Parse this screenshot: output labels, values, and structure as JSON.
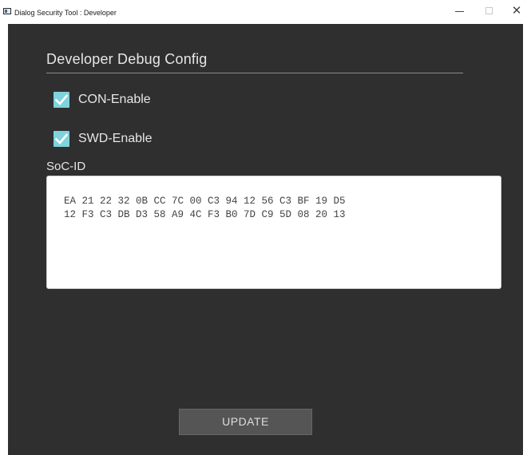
{
  "window": {
    "title": "Dialog Security Tool : Developer",
    "icon": "app-window-icon",
    "controls": {
      "minimize_icon": "minimize-icon",
      "maximize_icon": "maximize-icon",
      "close_glyph": "✕"
    }
  },
  "config": {
    "section_title": "Developer Debug Config",
    "checkboxes": [
      {
        "label": "CON-Enable",
        "checked": true
      },
      {
        "label": "SWD-Enable",
        "checked": true
      }
    ],
    "soc_id": {
      "label": "SoC-ID",
      "lines": [
        "EA 21 22 32 0B CC 7C 00 C3 94 12 56 C3 BF 19 D5",
        "12 F3 C3 DB D3 58 A9 4C F3 B0 7D C9 5D 08 20 13"
      ]
    },
    "update_button": "UPDATE"
  },
  "colors": {
    "background": "#2f2f2f",
    "checkbox_fill": "#7fd3dc",
    "button_fill": "#555555",
    "text": "#e6e6e6"
  }
}
